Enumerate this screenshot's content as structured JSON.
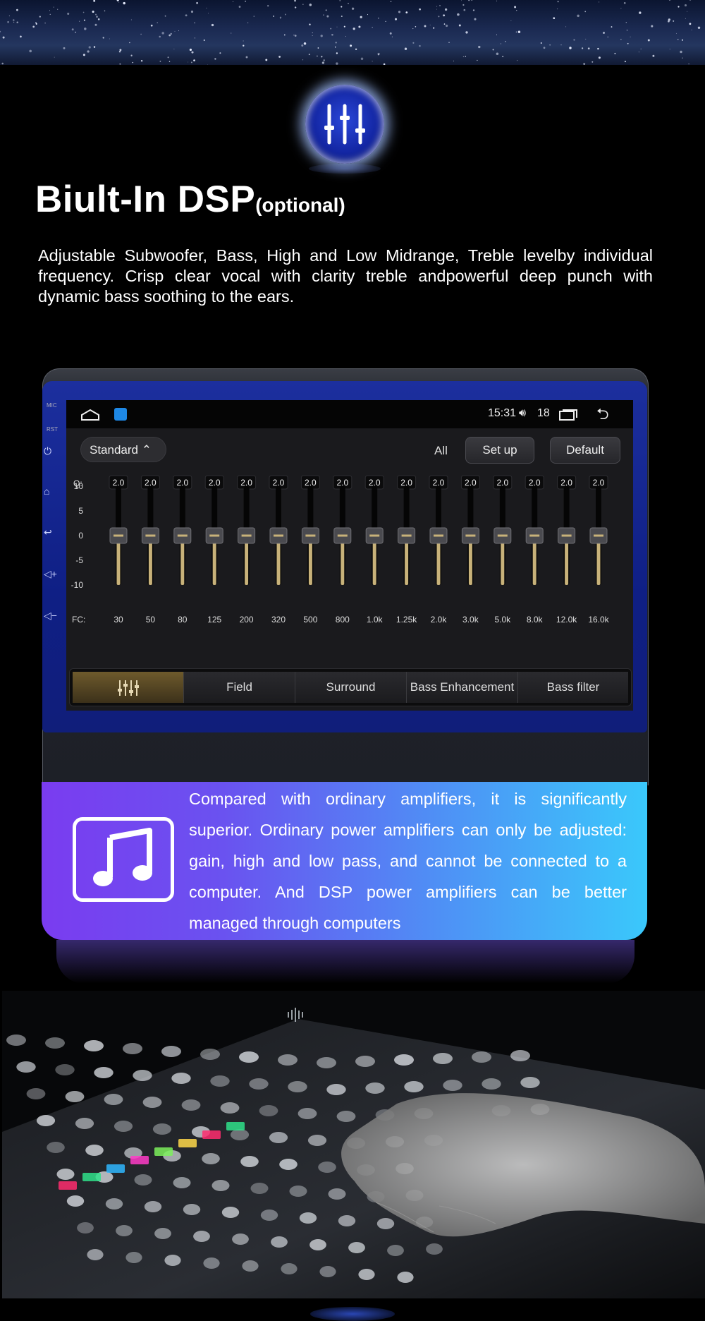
{
  "heading": {
    "main": "Biult-In DSP",
    "sub": "(optional)"
  },
  "intro": "Adjustable Subwoofer, Bass, High and Low Midrange, Treble levelby individual frequency. Crisp clear vocal with clarity treble andpowerful deep punch with dynamic bass soothing to the ears.",
  "device": {
    "side_labels": [
      "MIC",
      "RST"
    ],
    "side_icons": [
      "power-icon",
      "home-icon",
      "back-icon",
      "volume-up-icon",
      "volume-down-icon"
    ],
    "status": {
      "time": "15:31",
      "volume": "18"
    },
    "preset": "Standard",
    "all_label": "All",
    "setup": "Set up",
    "default": "Default",
    "q_label": "Q:",
    "fc_label": "FC:",
    "y_ticks": [
      "10",
      "5",
      "0",
      "-5",
      "-10"
    ],
    "bands": [
      {
        "fc": "30",
        "q": "2.0",
        "gain": 0
      },
      {
        "fc": "50",
        "q": "2.0",
        "gain": 0
      },
      {
        "fc": "80",
        "q": "2.0",
        "gain": 0
      },
      {
        "fc": "125",
        "q": "2.0",
        "gain": 0
      },
      {
        "fc": "200",
        "q": "2.0",
        "gain": 0
      },
      {
        "fc": "320",
        "q": "2.0",
        "gain": 0
      },
      {
        "fc": "500",
        "q": "2.0",
        "gain": 0
      },
      {
        "fc": "800",
        "q": "2.0",
        "gain": 0
      },
      {
        "fc": "1.0k",
        "q": "2.0",
        "gain": 0
      },
      {
        "fc": "1.25k",
        "q": "2.0",
        "gain": 0
      },
      {
        "fc": "2.0k",
        "q": "2.0",
        "gain": 0
      },
      {
        "fc": "3.0k",
        "q": "2.0",
        "gain": 0
      },
      {
        "fc": "5.0k",
        "q": "2.0",
        "gain": 0
      },
      {
        "fc": "8.0k",
        "q": "2.0",
        "gain": 0
      },
      {
        "fc": "12.0k",
        "q": "2.0",
        "gain": 0
      },
      {
        "fc": "16.0k",
        "q": "2.0",
        "gain": 0
      }
    ],
    "gain_range": [
      -10,
      10
    ],
    "tabs": [
      {
        "label": "",
        "icon": "equalizer-icon",
        "active": true
      },
      {
        "label": "Field",
        "active": false
      },
      {
        "label": "Surround",
        "active": false
      },
      {
        "label": "Bass Enhancement",
        "active": false
      },
      {
        "label": "Bass filter",
        "active": false
      }
    ],
    "accent": "#c8b27a"
  },
  "feature": {
    "icon": "music-note-icon",
    "text": "Compared with ordinary amplifiers, it is significantly superior. Ordinary power amplifiers can only be adjusted: gain, high and low pass, and cannot be connected to a computer. And DSP power amplifiers can be better managed through computers"
  }
}
